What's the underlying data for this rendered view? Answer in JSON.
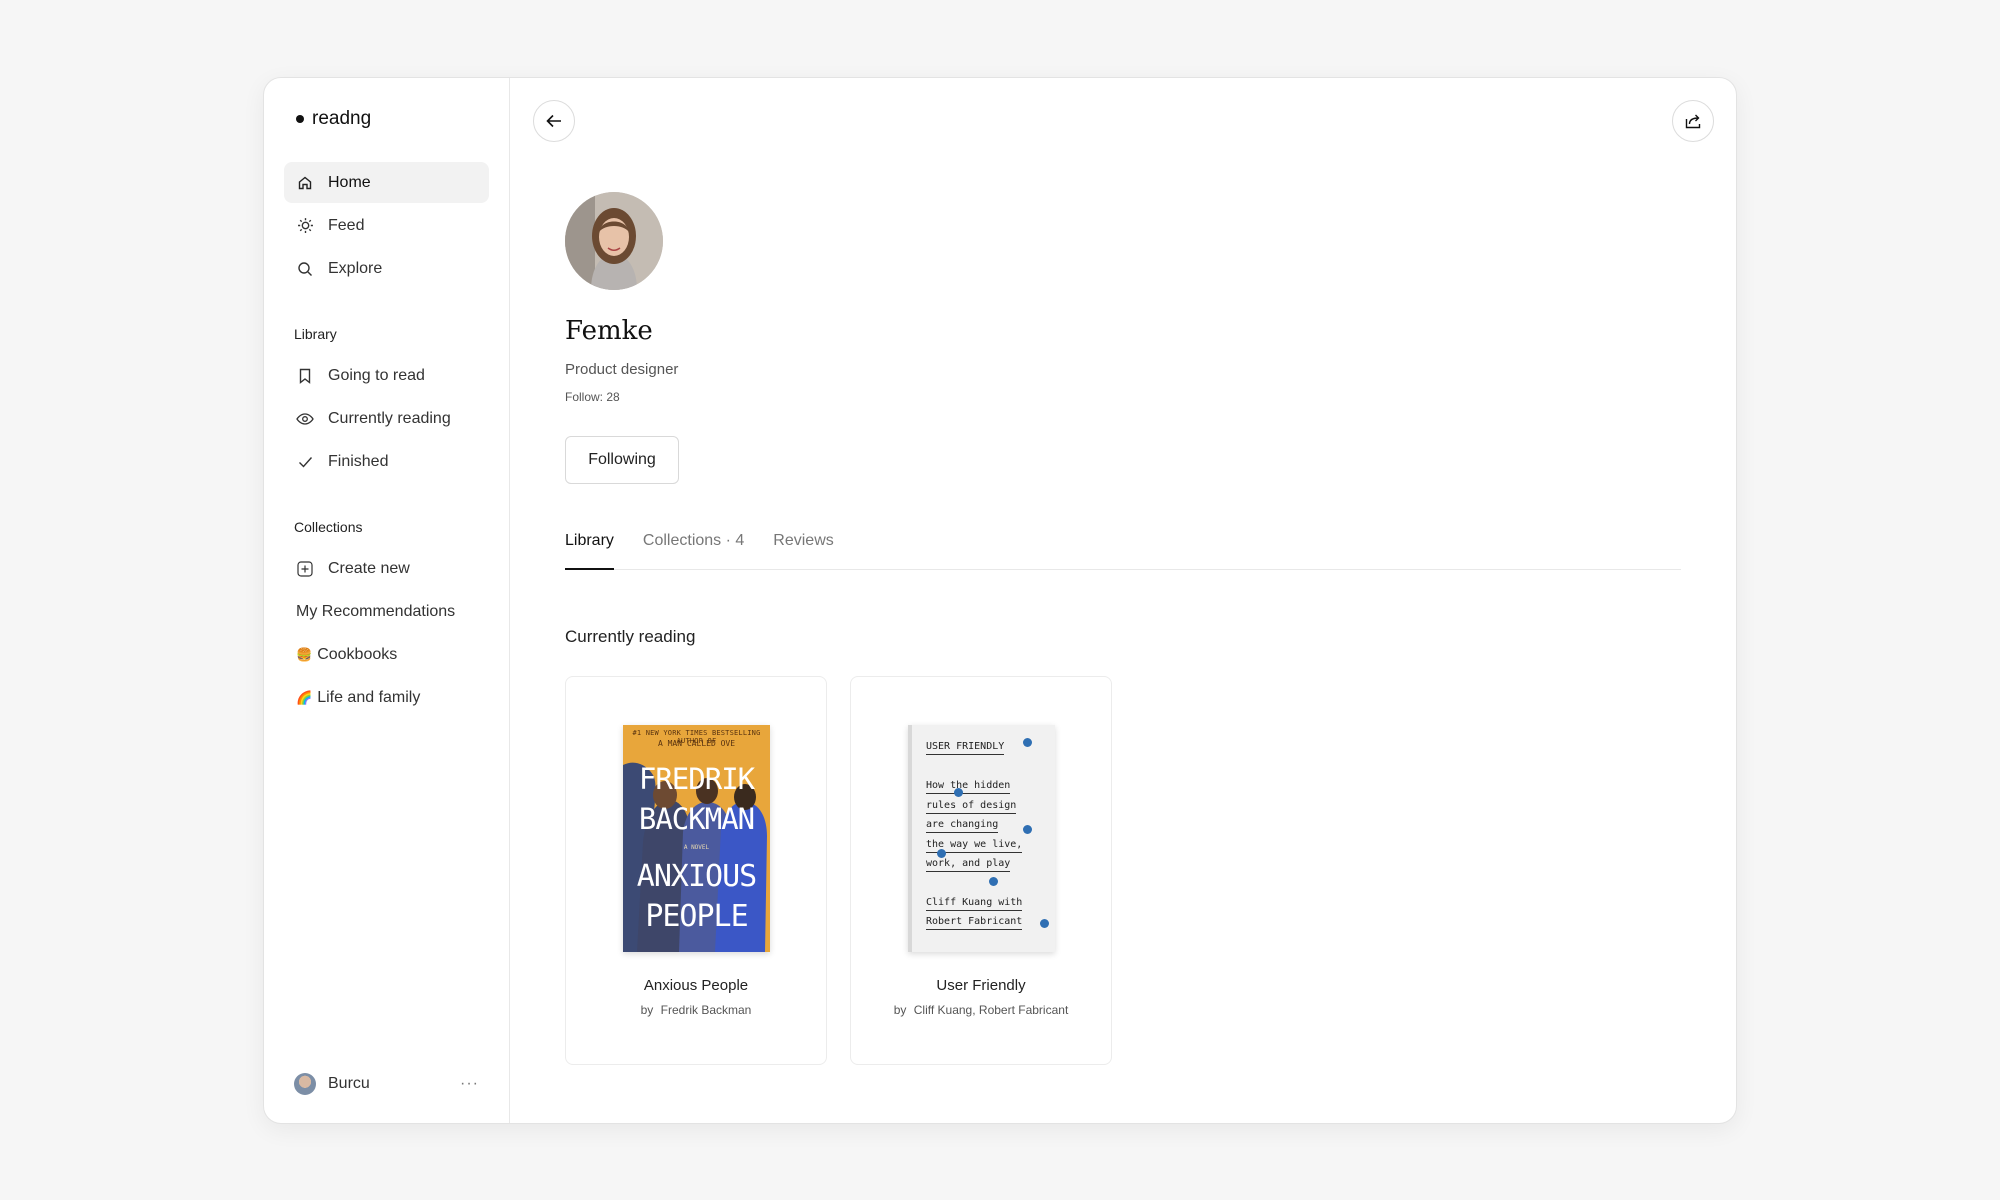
{
  "app": {
    "name": "readng"
  },
  "sidebar": {
    "nav": [
      {
        "label": "Home",
        "icon": "home-icon",
        "active": true
      },
      {
        "label": "Feed",
        "icon": "sun-icon"
      },
      {
        "label": "Explore",
        "icon": "search-icon"
      }
    ],
    "library_label": "Library",
    "library": [
      {
        "label": "Going to read",
        "icon": "bookmark-icon"
      },
      {
        "label": "Currently reading",
        "icon": "eye-icon"
      },
      {
        "label": "Finished",
        "icon": "check-icon"
      }
    ],
    "collections_label": "Collections",
    "collections": [
      {
        "label": "Create new",
        "icon": "plus-square-icon"
      },
      {
        "label": "My Recommendations"
      },
      {
        "label": "Cookbooks",
        "emoji": "🍔"
      },
      {
        "label": "Life and family",
        "emoji": "🌈"
      }
    ],
    "user": {
      "name": "Burcu",
      "more": "···"
    }
  },
  "profile": {
    "name": "Femke",
    "role": "Product designer",
    "follow": "Follow: 28",
    "following_button": "Following"
  },
  "tabs": [
    {
      "label": "Library",
      "active": true
    },
    {
      "label": "Collections · 4"
    },
    {
      "label": "Reviews"
    }
  ],
  "section_title": "Currently reading",
  "books": [
    {
      "title": "Anxious People",
      "by": "by",
      "author": "Fredrik Backman",
      "cover": {
        "top": "#1 NEW YORK TIMES BESTSELLING AUTHOR OF",
        "top2": "A MAN CALLED OVE",
        "author_line1": "FREDRIK",
        "author_line2": "BACKMAN",
        "novel": "A NOVEL",
        "title_line1": "ANXIOUS",
        "title_line2": "PEOPLE"
      }
    },
    {
      "title": "User Friendly",
      "by": "by",
      "author": "Cliff Kuang, Robert Fabricant",
      "cover": {
        "lines": [
          "USER FRIENDLY",
          "How the hidden",
          "rules of design",
          "are changing",
          "the way we live,",
          "work, and play",
          "Cliff Kuang with",
          "Robert Fabricant"
        ]
      }
    }
  ],
  "colors": {
    "accent_blue": "#2f6fb3",
    "cover_orange": "#e8a63b"
  }
}
